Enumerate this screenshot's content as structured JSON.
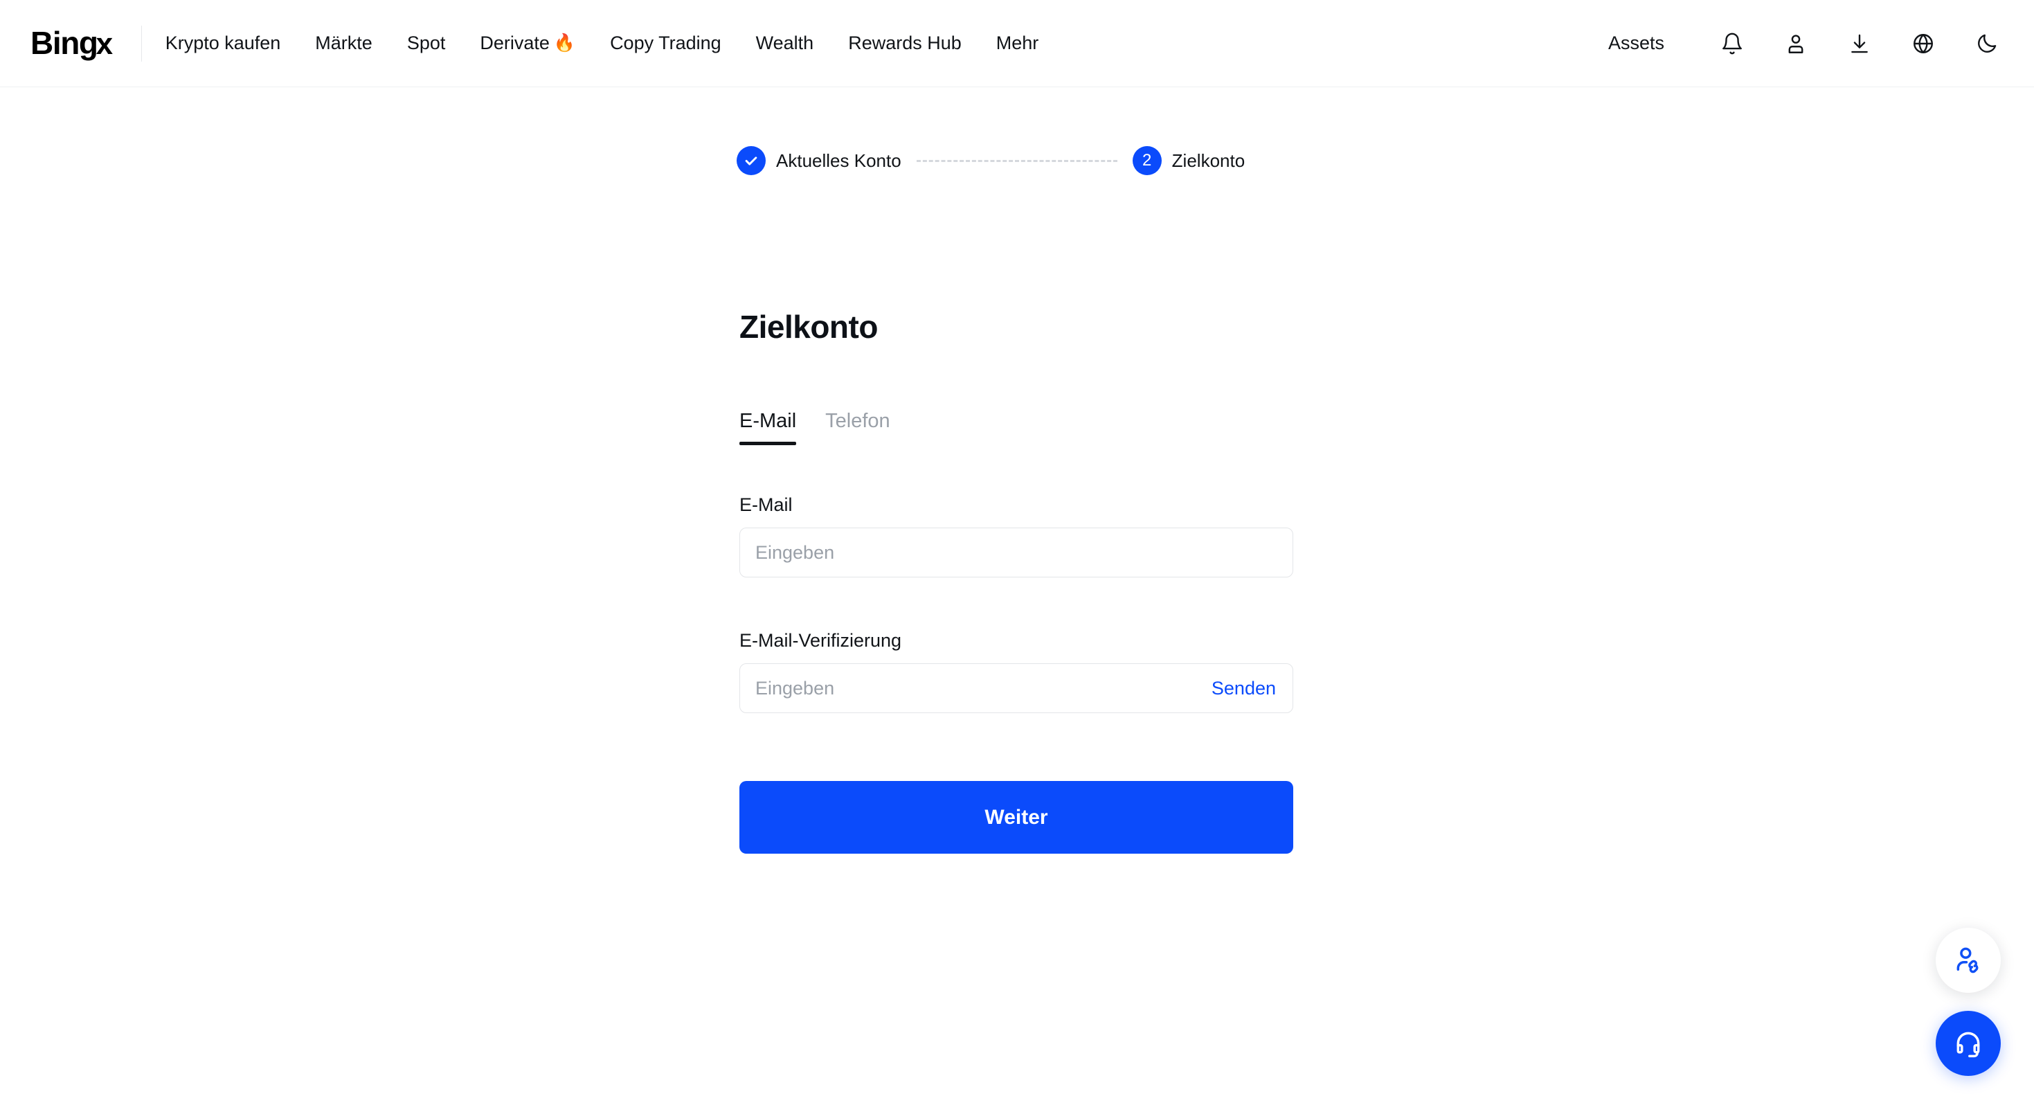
{
  "brand": {
    "name": "BingX",
    "logo_text_main": "Bing",
    "logo_text_x": "x",
    "accent_color": "#0B4BFB",
    "text_color": "#111418",
    "muted_color": "#9aa0a8",
    "border_color": "#e3e5e8"
  },
  "header": {
    "nav_items": [
      {
        "label": "Krypto kaufen",
        "icon": ""
      },
      {
        "label": "Märkte",
        "icon": ""
      },
      {
        "label": "Spot",
        "icon": ""
      },
      {
        "label": "Derivate",
        "icon": "🔥"
      },
      {
        "label": "Copy Trading",
        "icon": ""
      },
      {
        "label": "Wealth",
        "icon": ""
      },
      {
        "label": "Rewards Hub",
        "icon": ""
      },
      {
        "label": "Mehr",
        "icon": ""
      }
    ],
    "assets_label": "Assets",
    "icons": [
      {
        "name": "bell-icon",
        "title": "Benachrichtigungen"
      },
      {
        "name": "user-icon",
        "title": "Konto"
      },
      {
        "name": "download-icon",
        "title": "App herunterladen"
      },
      {
        "name": "globe-icon",
        "title": "Sprache"
      },
      {
        "name": "moon-icon",
        "title": "Dunkelmodus"
      }
    ]
  },
  "stepper": {
    "steps": [
      {
        "marker": "✓",
        "label": "Aktuelles Konto",
        "state": "completed"
      },
      {
        "marker": "2",
        "label": "Zielkonto",
        "state": "current"
      }
    ]
  },
  "main": {
    "title": "Zielkonto",
    "tabs": [
      {
        "label": "E-Mail",
        "active": true
      },
      {
        "label": "Telefon",
        "active": false
      }
    ],
    "fields": {
      "email": {
        "label": "E-Mail",
        "placeholder": "Eingeben",
        "value": ""
      },
      "verification": {
        "label": "E-Mail-Verifizierung",
        "placeholder": "Eingeben",
        "value": "",
        "action_label": "Senden"
      }
    },
    "submit_label": "Weiter"
  },
  "floating": {
    "referral": {
      "name": "referral-icon",
      "title": "Einladen"
    },
    "support": {
      "name": "headset-icon",
      "title": "Kundenservice"
    }
  }
}
